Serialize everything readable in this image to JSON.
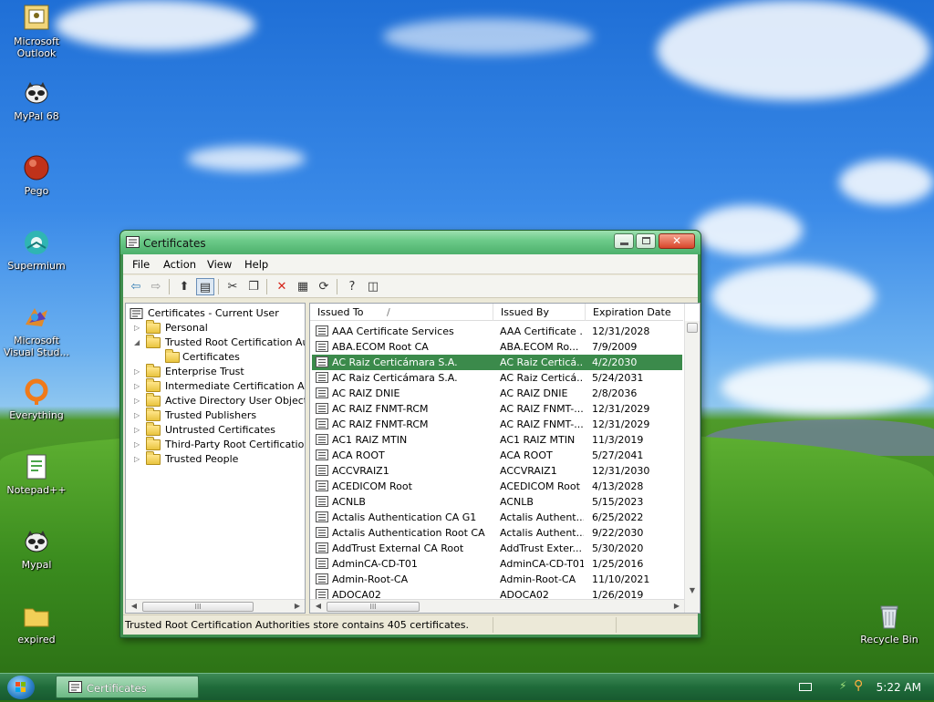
{
  "desktop": {
    "icons": [
      {
        "label": "Microsoft Outlook"
      },
      {
        "label": "MyPal 68"
      },
      {
        "label": "Pego"
      },
      {
        "label": "Supermium"
      },
      {
        "label": "Microsoft Visual Stud..."
      },
      {
        "label": "Everything"
      },
      {
        "label": "Notepad++"
      },
      {
        "label": "Mypal"
      },
      {
        "label": "expired"
      },
      {
        "label": "Recycle Bin"
      }
    ]
  },
  "window": {
    "title": "Certificates",
    "menu": [
      "File",
      "Action",
      "View",
      "Help"
    ],
    "tree": {
      "root": "Certificates - Current User",
      "items": [
        {
          "label": "Personal"
        },
        {
          "label": "Trusted Root Certification Aut"
        },
        {
          "label": "Certificates"
        },
        {
          "label": "Enterprise Trust"
        },
        {
          "label": "Intermediate Certification Aut"
        },
        {
          "label": "Active Directory User Object"
        },
        {
          "label": "Trusted Publishers"
        },
        {
          "label": "Untrusted Certificates"
        },
        {
          "label": "Third-Party Root Certification"
        },
        {
          "label": "Trusted People"
        }
      ]
    },
    "list": {
      "columns": [
        "Issued To",
        "Issued By",
        "Expiration Date"
      ],
      "sort_indicator": "/",
      "rows": [
        {
          "issued_to": "AAA Certificate Services",
          "issued_by": "AAA Certificate ...",
          "expires": "12/31/2028"
        },
        {
          "issued_to": "ABA.ECOM Root CA",
          "issued_by": "ABA.ECOM Ro...",
          "expires": "7/9/2009"
        },
        {
          "issued_to": "AC Raiz Certicámara S.A.",
          "issued_by": "AC Raiz Certicá...",
          "expires": "4/2/2030"
        },
        {
          "issued_to": "AC Raiz Certicámara S.A.",
          "issued_by": "AC Raiz Certicá...",
          "expires": "5/24/2031"
        },
        {
          "issued_to": "AC RAIZ DNIE",
          "issued_by": "AC RAIZ DNIE",
          "expires": "2/8/2036"
        },
        {
          "issued_to": "AC RAIZ FNMT-RCM",
          "issued_by": "AC RAIZ FNMT-...",
          "expires": "12/31/2029"
        },
        {
          "issued_to": "AC RAIZ FNMT-RCM",
          "issued_by": "AC RAIZ FNMT-...",
          "expires": "12/31/2029"
        },
        {
          "issued_to": "AC1 RAIZ MTIN",
          "issued_by": "AC1 RAIZ MTIN",
          "expires": "11/3/2019"
        },
        {
          "issued_to": "ACA ROOT",
          "issued_by": "ACA ROOT",
          "expires": "5/27/2041"
        },
        {
          "issued_to": "ACCVRAIZ1",
          "issued_by": "ACCVRAIZ1",
          "expires": "12/31/2030"
        },
        {
          "issued_to": "ACEDICOM Root",
          "issued_by": "ACEDICOM Root",
          "expires": "4/13/2028"
        },
        {
          "issued_to": "ACNLB",
          "issued_by": "ACNLB",
          "expires": "5/15/2023"
        },
        {
          "issued_to": "Actalis Authentication CA G1",
          "issued_by": "Actalis Authent...",
          "expires": "6/25/2022"
        },
        {
          "issued_to": "Actalis Authentication Root CA",
          "issued_by": "Actalis Authent...",
          "expires": "9/22/2030"
        },
        {
          "issued_to": "AddTrust External CA Root",
          "issued_by": "AddTrust Exter...",
          "expires": "5/30/2020"
        },
        {
          "issued_to": "AdminCA-CD-T01",
          "issued_by": "AdminCA-CD-T01",
          "expires": "1/25/2016"
        },
        {
          "issued_to": "Admin-Root-CA",
          "issued_by": "Admin-Root-CA",
          "expires": "11/10/2021"
        },
        {
          "issued_to": "ADOCA02",
          "issued_by": "ADOCA02",
          "expires": "1/26/2019"
        }
      ]
    },
    "status": "Trusted Root Certification Authorities store contains 405 certificates.",
    "scroll_thumb_glyph": "III"
  },
  "taskbar": {
    "task_label": "Certificates",
    "clock": "5:22 AM"
  },
  "colors": {
    "selection": "#3b8a4b",
    "titlebar": "#6dcb8a",
    "taskbar": "#1f6b3a"
  }
}
